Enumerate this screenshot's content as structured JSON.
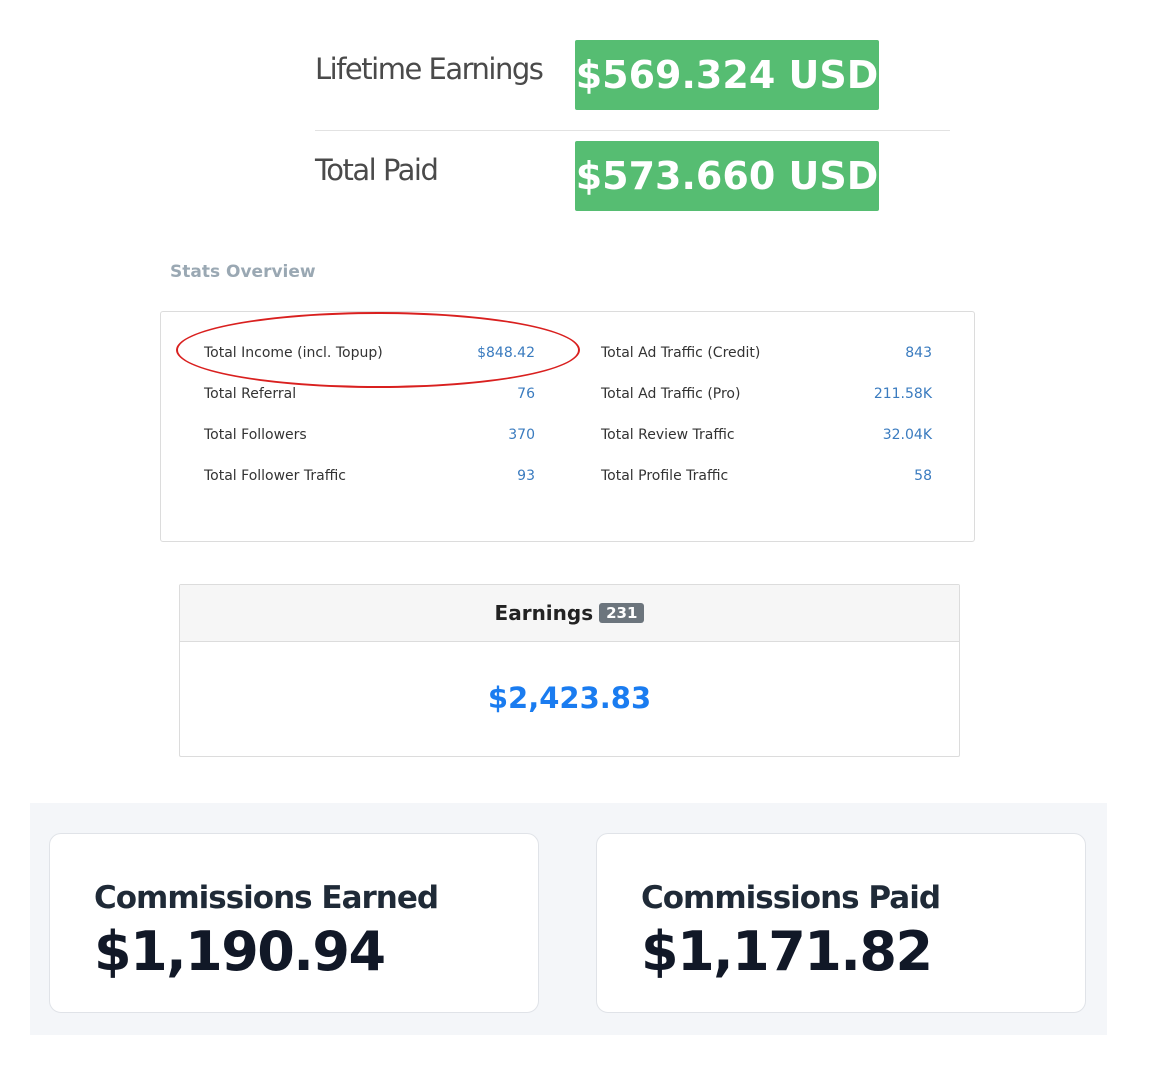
{
  "earnings_summary": {
    "lifetime": {
      "label": "Lifetime Earnings",
      "value": "$569.324 USD"
    },
    "paid": {
      "label": "Total Paid",
      "value": "$573.660 USD"
    },
    "badge_color": "#56bd72"
  },
  "stats": {
    "title": "Stats Overview",
    "left": [
      {
        "label": "Total Income (incl. Topup)",
        "value": "$848.42"
      },
      {
        "label": "Total Referral",
        "value": "76"
      },
      {
        "label": "Total Followers",
        "value": "370"
      },
      {
        "label": "Total Follower Traffic",
        "value": "93"
      }
    ],
    "right": [
      {
        "label": "Total Ad Traffic (Credit)",
        "value": "843"
      },
      {
        "label": "Total Ad Traffic (Pro)",
        "value": "211.58K"
      },
      {
        "label": "Total Review Traffic",
        "value": "32.04K"
      },
      {
        "label": "Total Profile Traffic",
        "value": "58"
      }
    ],
    "highlight_color": "#d9201f"
  },
  "earnings_card": {
    "title": "Earnings",
    "count": "231",
    "value": "$2,423.83"
  },
  "commissions": {
    "earned": {
      "label": "Commissions Earned",
      "value": "$1,190.94"
    },
    "paid": {
      "label": "Commissions Paid",
      "value": "$1,171.82"
    }
  }
}
